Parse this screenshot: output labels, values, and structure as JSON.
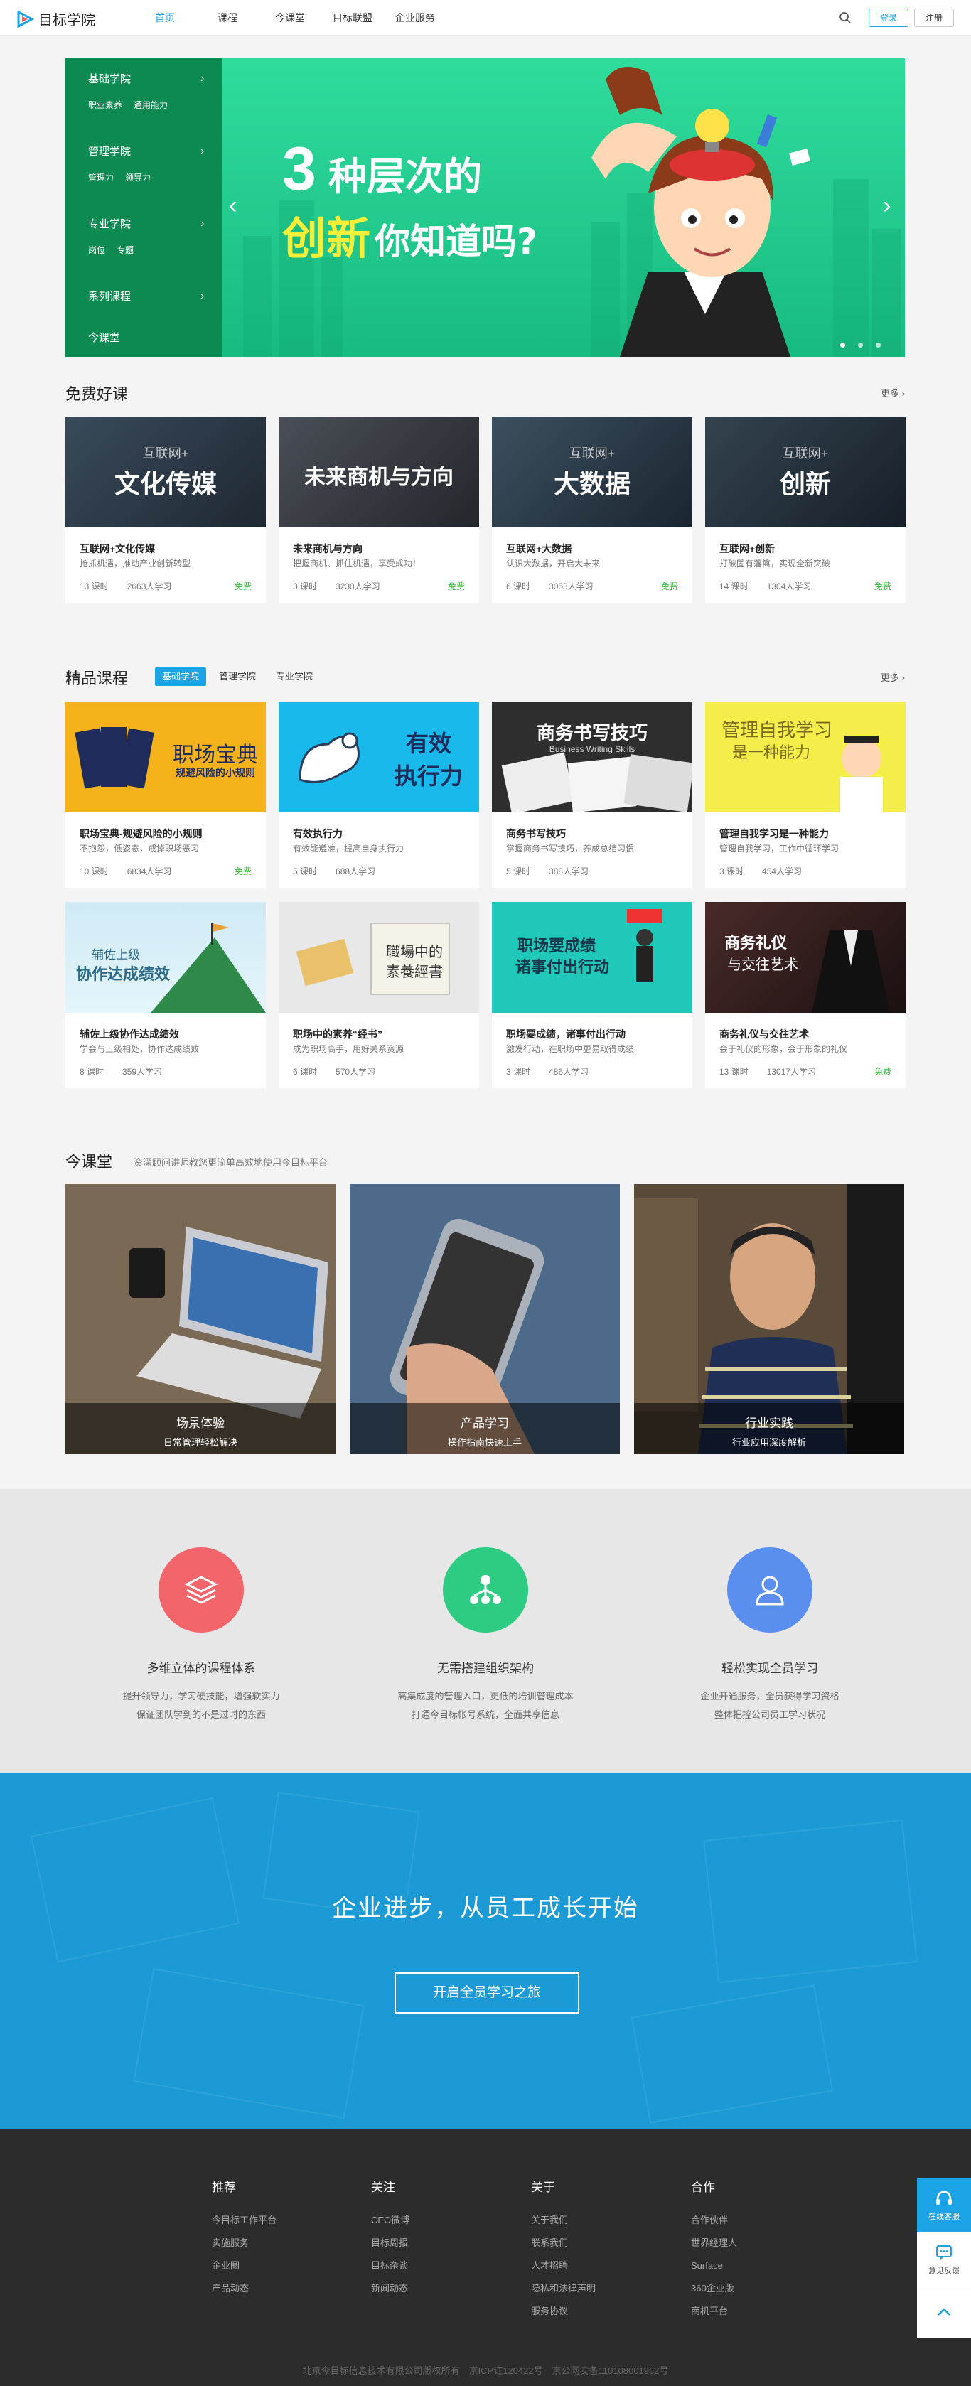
{
  "header": {
    "logo_text": "目标学院",
    "nav": [
      "首页",
      "课程",
      "今课堂",
      "目标联盟",
      "企业服务"
    ],
    "login": "登录",
    "register": "注册",
    "brand_color": "#1ca3e6"
  },
  "banner": {
    "menu": [
      {
        "title": "基础学院",
        "links": [
          "职业素养",
          "通用能力"
        ]
      },
      {
        "title": "管理学院",
        "links": [
          "管理力",
          "领导力"
        ]
      },
      {
        "title": "专业学院",
        "links": [
          "岗位",
          "专题"
        ]
      },
      {
        "title": "系列课程",
        "links": []
      },
      {
        "title": "今课堂",
        "links": []
      }
    ],
    "headline_num": "3",
    "headline_rest": "种层次的",
    "headline2_a": "创新",
    "headline2_b": "你知道吗?",
    "prev": "‹",
    "next": "›"
  },
  "free": {
    "title": "免费好课",
    "more": "更多 ›",
    "cards": [
      {
        "thumb_small": "互联网+",
        "thumb_big": "文化传媒",
        "title": "互联网+文化传媒",
        "desc": "抢抓机遇，推动产业创新转型",
        "lessons": "13 课时",
        "learners": "2663人学习",
        "tag": "免费"
      },
      {
        "thumb_small": "",
        "thumb_big": "未来商机与方向",
        "title": "未来商机与方向",
        "desc": "把握商机、抓住机遇，享受成功！",
        "lessons": "3 课时",
        "learners": "3230人学习",
        "tag": "免费"
      },
      {
        "thumb_small": "互联网+",
        "thumb_big": "大数据",
        "title": "互联网+大数据",
        "desc": "认识大数据，开启大未来",
        "lessons": "6 课时",
        "learners": "3053人学习",
        "tag": "免费"
      },
      {
        "thumb_small": "互联网+",
        "thumb_big": "创新",
        "title": "互联网+创新",
        "desc": "打破固有藩篱，实现全新突破",
        "lessons": "14 课时",
        "learners": "1304人学习",
        "tag": "免费"
      }
    ]
  },
  "premium": {
    "title": "精品课程",
    "tabs": [
      "基础学院",
      "管理学院",
      "专业学院"
    ],
    "more": "更多 ›",
    "cards": [
      {
        "thumb_big": "职场宝典",
        "thumb_small": "规避风险的小规则",
        "title": "职场宝典-规避风险的小规则",
        "desc": "不抱怨，低姿态，戒掉职场恶习",
        "lessons": "10 课时",
        "learners": "6834人学习",
        "tag": "免费"
      },
      {
        "thumb_big": "有效",
        "thumb_small": "执行力",
        "title": "有效执行力",
        "desc": "有效能遵准，提高自身执行力",
        "lessons": "5 课时",
        "learners": "688人学习",
        "tag": ""
      },
      {
        "thumb_big": "商务书写技巧",
        "thumb_small": "Business Writing Skills",
        "title": "商务书写技巧",
        "desc": "掌握商务书写技巧，养成总结习惯",
        "lessons": "5 课时",
        "learners": "388人学习",
        "tag": ""
      },
      {
        "thumb_big": "管理自我学习",
        "thumb_small": "是一种能力",
        "title": "管理自我学习是一种能力",
        "desc": "管理自我学习，工作中循环学习",
        "lessons": "3 课时",
        "learners": "454人学习",
        "tag": ""
      },
      {
        "thumb_big": "辅佐上级",
        "thumb_small": "协作达成绩效",
        "title": "辅佐上级协作达成绩效",
        "desc": "学会与上级相处，协作达成绩效",
        "lessons": "8 课时",
        "learners": "359人学习",
        "tag": ""
      },
      {
        "thumb_big": "職場中的",
        "thumb_small": "素養經書",
        "title": "职场中的素养“经书”",
        "desc": "成为职场高手，用好关系资源",
        "lessons": "6 课时",
        "learners": "570人学习",
        "tag": ""
      },
      {
        "thumb_big": "职场要成绩",
        "thumb_small": "诸事付出行动",
        "title": "职场要成绩，诸事付出行动",
        "desc": "激发行动，在职场中更易取得成绩",
        "lessons": "3 课时",
        "learners": "486人学习",
        "tag": ""
      },
      {
        "thumb_big": "商务礼仪",
        "thumb_small": "与交往艺术",
        "title": "商务礼仪与交往艺术",
        "desc": "会于礼仪的形象，会于形象的礼仪",
        "lessons": "13 课时",
        "learners": "13017人学习",
        "tag": "免费"
      }
    ]
  },
  "lessons": {
    "title": "今课堂",
    "subtitle": "资深顾问讲师教您更简单高效地使用今目标平台",
    "items": [
      {
        "title": "场景体验",
        "sub": "日常管理轻松解决"
      },
      {
        "title": "产品学习",
        "sub": "操作指南快速上手"
      },
      {
        "title": "行业实践",
        "sub": "行业应用深度解析"
      }
    ]
  },
  "features": [
    {
      "title": "多维立体的课程体系",
      "desc1": "提升领导力，学习硬技能，增强软实力",
      "desc2": "保证团队学到的不是过时的东西",
      "color": "#f2656b",
      "icon": "stack-icon"
    },
    {
      "title": "无需搭建组织架构",
      "desc1": "高集成度的管理入口，更低的培训管理成本",
      "desc2": "打通今目标帐号系统，全面共享信息",
      "color": "#2ecc82",
      "icon": "org-icon"
    },
    {
      "title": "轻松实现全员学习",
      "desc1": "企业开通服务，全员获得学习资格",
      "desc2": "整体把控公司员工学习状况",
      "color": "#5a8ff0",
      "icon": "user-icon"
    }
  ],
  "cta": {
    "title": "企业进步，从员工成长开始",
    "button": "开启全员学习之旅"
  },
  "footer": {
    "columns": [
      {
        "title": "推荐",
        "links": [
          "今目标工作平台",
          "实施服务",
          "企业圈",
          "产品动态"
        ]
      },
      {
        "title": "关注",
        "links": [
          "CEO微博",
          "目标周报",
          "目标杂谈",
          "新闻动态"
        ]
      },
      {
        "title": "关于",
        "links": [
          "关于我们",
          "联系我们",
          "人才招聘",
          "隐私和法律声明",
          "服务协议"
        ]
      },
      {
        "title": "合作",
        "links": [
          "合作伙伴",
          "世界经理人",
          "Surface",
          "360企业版",
          "商机平台"
        ]
      }
    ],
    "copyright": "北京今目标信息技术有限公司版权所有　京ICP证120422号　京公网安备110108001962号"
  },
  "floating": {
    "service": "在线客服",
    "feedback": "意见反馈"
  }
}
